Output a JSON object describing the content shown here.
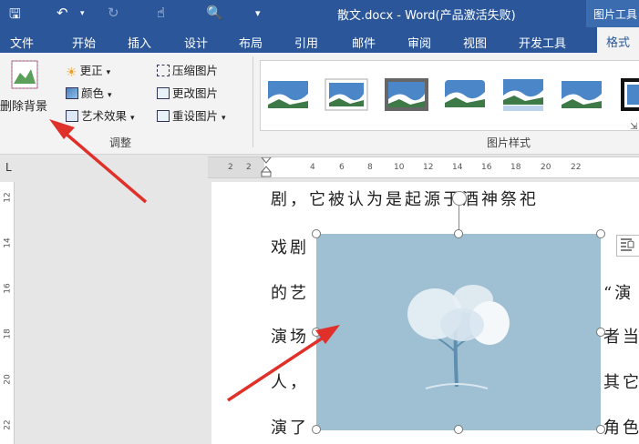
{
  "titlebar": {
    "document_title": "散文.docx - Word(产品激活失败)",
    "tools_title": "图片工具"
  },
  "tabs": [
    "文件",
    "开始",
    "插入",
    "设计",
    "布局",
    "引用",
    "邮件",
    "审阅",
    "视图",
    "开发工具"
  ],
  "active_tab": "格式",
  "ribbon": {
    "remove_background": "删除背景",
    "corrections": "更正",
    "color": "颜色",
    "artistic_effects": "艺术效果",
    "compress": "压缩图片",
    "change_picture": "更改图片",
    "reset_picture": "重设图片",
    "adjust_group": "调整",
    "styles_group": "图片样式"
  },
  "ruler": {
    "corner": "L",
    "h_ticks": [
      "2",
      "2",
      "4",
      "6",
      "8",
      "10",
      "12",
      "14",
      "16",
      "18",
      "20",
      "22"
    ],
    "v_ticks": [
      "12",
      "14",
      "16",
      "18",
      "20",
      "22"
    ]
  },
  "document": {
    "lines": [
      "剧，它被认为是起源于酒神祭祀",
      "戏剧",
      "的艺",
      "演场",
      "人，",
      "演了"
    ],
    "right_fragments": [
      "“演",
      "者当",
      "其它",
      "角色"
    ]
  },
  "colors": {
    "title_blue": "#2b579a",
    "ribbon_bg": "#f3f3f3",
    "arrow_red": "#e0302a",
    "picture_bg": "#9fbfd2"
  }
}
